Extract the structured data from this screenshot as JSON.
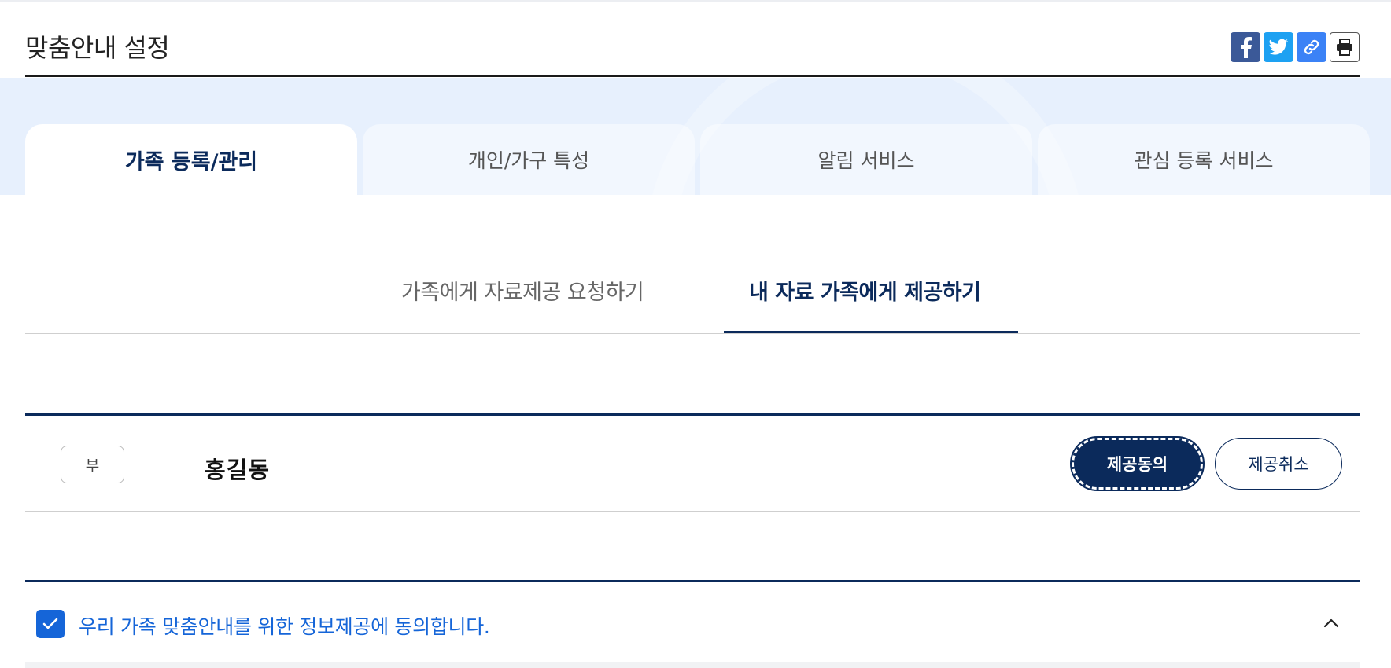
{
  "page": {
    "title": "맞춤안내 설정"
  },
  "share": {
    "facebook_icon": "facebook-icon",
    "twitter_icon": "twitter-icon",
    "link_icon": "link-icon",
    "print_icon": "printer-icon"
  },
  "main_tabs": [
    {
      "label": "가족 등록/관리",
      "active": true
    },
    {
      "label": "개인/가구 특성",
      "active": false
    },
    {
      "label": "알림 서비스",
      "active": false
    },
    {
      "label": "관심 등록 서비스",
      "active": false
    }
  ],
  "sub_tabs": [
    {
      "label": "가족에게 자료제공 요청하기",
      "active": false
    },
    {
      "label": "내 자료 가족에게 제공하기",
      "active": true
    }
  ],
  "member": {
    "relation": "부",
    "name": "홍길동",
    "agree_label": "제공동의",
    "cancel_label": "제공취소"
  },
  "consent": {
    "checked": true,
    "label": "우리 가족 맞춤안내를 위한 정보제공에 동의합니다.",
    "expanded": true
  },
  "colors": {
    "primary_navy": "#0b2a5b",
    "accent_blue": "#1565d8",
    "band_bg": "#e7f0fd"
  }
}
